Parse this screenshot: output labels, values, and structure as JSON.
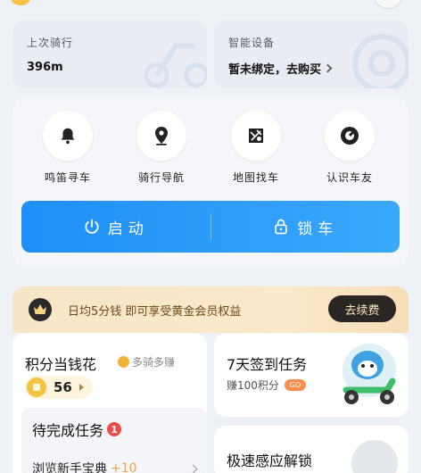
{
  "stats": {
    "last_ride": {
      "title": "上次骑行",
      "value": "396m"
    },
    "device": {
      "title": "智能设备",
      "link": "暂未绑定，去购买"
    }
  },
  "functions": [
    {
      "label": "鸣笛寻车",
      "icon": "bell-icon"
    },
    {
      "label": "骑行导航",
      "icon": "location-pin-icon"
    },
    {
      "label": "地图找车",
      "icon": "map-icon"
    },
    {
      "label": "认识车友",
      "icon": "compass-icon"
    }
  ],
  "actions": {
    "start_label": "启动",
    "lock_label": "锁车",
    "start_icon": "power-icon",
    "lock_icon": "lock-icon"
  },
  "membership": {
    "text": "日均5分钱 即可享受黄金会员权益",
    "button": "去续费",
    "icon": "crown-icon"
  },
  "points": {
    "title": "积分当钱花",
    "subtitle": "多骑多赚",
    "value": "56",
    "tasks_title": "待完成任务",
    "tasks_badge": "1",
    "task_item": "浏览新手宝典",
    "task_reward": "+10"
  },
  "checkin": {
    "title": "7天签到任务",
    "subtitle": "赚100积分",
    "go_label": "GO"
  },
  "unlock": {
    "title": "极速感应解锁"
  },
  "colors": {
    "primary_blue": "#1f8ef7",
    "gold_banner": "#f7e6c6",
    "dark_button": "#2a2623",
    "badge_red": "#ef4b4b",
    "reward_orange": "#f0a545"
  }
}
